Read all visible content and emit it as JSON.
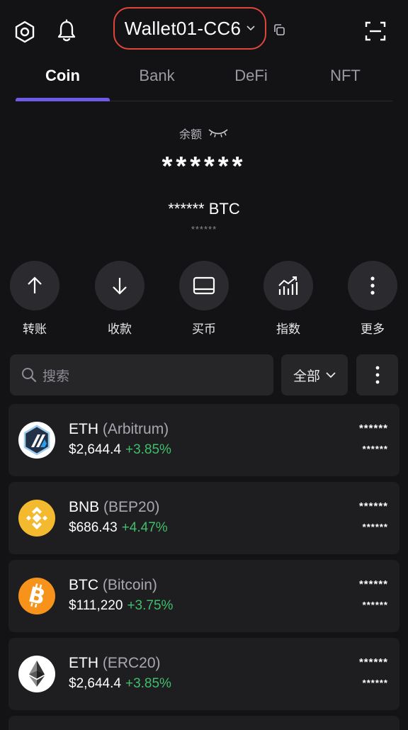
{
  "header": {
    "wallet_name": "Wallet01-CC6"
  },
  "tabs": [
    {
      "label": "Coin",
      "active": true
    },
    {
      "label": "Bank",
      "active": false
    },
    {
      "label": "DeFi",
      "active": false
    },
    {
      "label": "NFT",
      "active": false
    }
  ],
  "balance": {
    "label": "余额",
    "amount": "******",
    "btc": "****** BTC",
    "sub": "******"
  },
  "actions": [
    {
      "label": "转账",
      "icon": "arrow-up-icon"
    },
    {
      "label": "收款",
      "icon": "arrow-down-icon"
    },
    {
      "label": "买币",
      "icon": "card-icon"
    },
    {
      "label": "指数",
      "icon": "index-chart-icon"
    },
    {
      "label": "更多",
      "icon": "more-vertical-icon"
    }
  ],
  "search": {
    "placeholder": "搜索",
    "filter_label": "全部"
  },
  "tokens": [
    {
      "symbol": "ETH",
      "network": "(Arbitrum)",
      "price": "$2,644.4",
      "change": "+3.85%",
      "balance": "******",
      "value": "******",
      "icon": "arbitrum-logo"
    },
    {
      "symbol": "BNB",
      "network": "(BEP20)",
      "price": "$686.43",
      "change": "+4.47%",
      "balance": "******",
      "value": "******",
      "icon": "bnb-logo"
    },
    {
      "symbol": "BTC",
      "network": "(Bitcoin)",
      "price": "$111,220",
      "change": "+3.75%",
      "balance": "******",
      "value": "******",
      "icon": "bitcoin-logo"
    },
    {
      "symbol": "ETH",
      "network": "(ERC20)",
      "price": "$2,644.4",
      "change": "+3.85%",
      "balance": "******",
      "value": "******",
      "icon": "ethereum-logo"
    }
  ],
  "colors": {
    "background": "#131315",
    "card": "#1e1e21",
    "accent": "#6d5ae6",
    "positive": "#3fbf6b",
    "highlight_border": "#e0453a"
  }
}
